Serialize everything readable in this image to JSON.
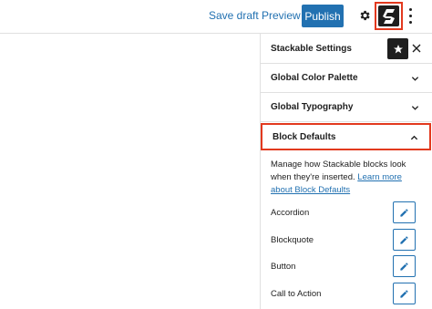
{
  "toolbar": {
    "save_draft_label": "Save draft",
    "preview_label": "Preview",
    "publish_label": "Publish"
  },
  "sidebar": {
    "title": "Stackable Settings",
    "panels": [
      {
        "label": "Global Color Palette",
        "state": "collapsed"
      },
      {
        "label": "Global Typography",
        "state": "collapsed"
      },
      {
        "label": "Block Defaults",
        "state": "expanded"
      }
    ],
    "block_defaults": {
      "description": "Manage how Stackable blocks look when they're inserted.",
      "link_text": "Learn more about Block Defaults",
      "blocks": [
        {
          "label": "Accordion"
        },
        {
          "label": "Blockquote"
        },
        {
          "label": "Button"
        },
        {
          "label": "Call to Action"
        }
      ]
    }
  },
  "colors": {
    "accent": "#2271b1",
    "highlight": "#e2391e",
    "dark": "#1e1e1e"
  }
}
